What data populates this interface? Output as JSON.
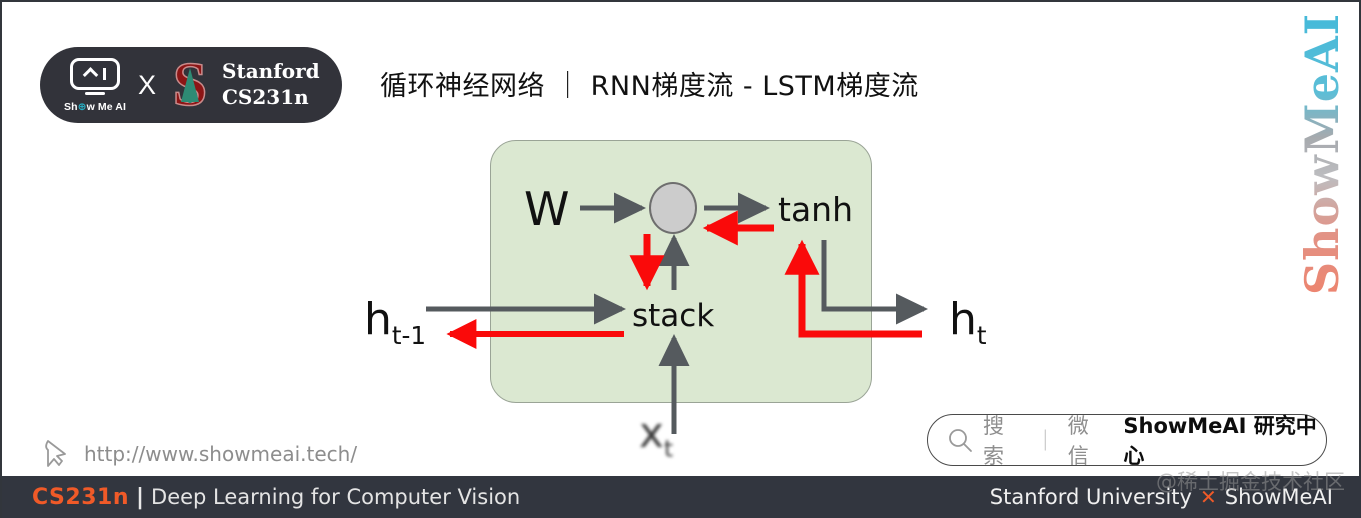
{
  "brand_badge": {
    "logo_icon": "showmeai-monitor-icon",
    "logo_text_pre": "Sh",
    "logo_text_dot": "⊕",
    "logo_text_post": "w Me AI",
    "x_separator": "X",
    "stanford_icon": "stanford-tree-logo",
    "stanford_line1": "Stanford",
    "stanford_line2": "CS231n"
  },
  "header": {
    "title": "循环神经网络 ｜ RNN梯度流 - LSTM梯度流"
  },
  "vertical_mark": {
    "text": "ShowMeAI"
  },
  "diagram": {
    "type": "rnn-cell-gradient-flow",
    "cell_box_color": "#dbe8d1",
    "forward_arrow_color": "#555a5e",
    "gradient_arrow_color": "#fa0a0a",
    "node_color": "#cccccc",
    "labels": {
      "weight": "W",
      "activation": "tanh",
      "concat": "stack",
      "hidden_prev_base": "h",
      "hidden_prev_sub": "t-1",
      "hidden_curr_base": "h",
      "hidden_curr_sub": "t",
      "input_base": "x",
      "input_sub": "t"
    }
  },
  "site_link": {
    "icon": "cursor-pointer-icon",
    "url": "http://www.showmeai.tech/"
  },
  "search_pill": {
    "icon": "search-icon",
    "placeholder": "搜索",
    "separator": "｜",
    "channel": "微信",
    "account": "ShowMeAI 研究中心"
  },
  "footer": {
    "course_code": "CS231n",
    "pipe": "|",
    "course_name": "Deep Learning for Computer Vision",
    "university": "Stanford University",
    "x_mark": "✕",
    "brand": "ShowMeAI",
    "accent_color": "#f05a28",
    "background_color": "#32363f"
  },
  "watermark": {
    "text": "@稀土掘金技术社区"
  }
}
